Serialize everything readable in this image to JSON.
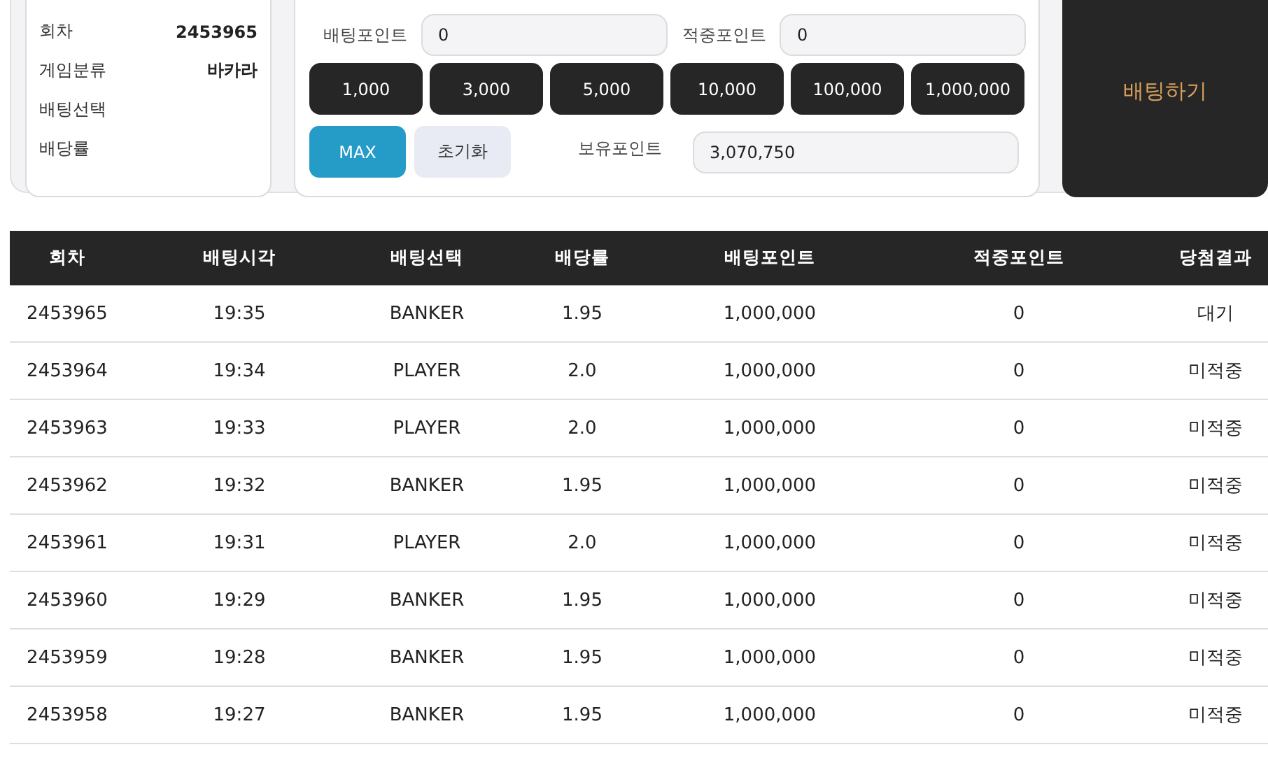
{
  "info": {
    "rows": [
      {
        "label": "회차",
        "value": "2453965"
      },
      {
        "label": "게임분류",
        "value": "바카라"
      },
      {
        "label": "배팅선택"
      },
      {
        "label": "배당률"
      }
    ]
  },
  "bet_point": {
    "label": "배팅포인트",
    "value": "0"
  },
  "win_point": {
    "label": "적중포인트",
    "value": "0"
  },
  "amount_buttons": [
    "1,000",
    "3,000",
    "5,000",
    "10,000",
    "100,000",
    "1,000,000"
  ],
  "max_button": "MAX",
  "reset_button": "초기화",
  "owned_point": {
    "label": "보유포인트",
    "value": "3,070,750"
  },
  "bet_button": "배팅하기",
  "table": {
    "columns": [
      "회차",
      "배팅시각",
      "배팅선택",
      "배당률",
      "배팅포인트",
      "적중포인트",
      "당첨결과"
    ],
    "rows": [
      [
        "2453965",
        "19:35",
        "BANKER",
        "1.95",
        "1,000,000",
        "0",
        "대기"
      ],
      [
        "2453964",
        "19:34",
        "PLAYER",
        "2.0",
        "1,000,000",
        "0",
        "미적중"
      ],
      [
        "2453963",
        "19:33",
        "PLAYER",
        "2.0",
        "1,000,000",
        "0",
        "미적중"
      ],
      [
        "2453962",
        "19:32",
        "BANKER",
        "1.95",
        "1,000,000",
        "0",
        "미적중"
      ],
      [
        "2453961",
        "19:31",
        "PLAYER",
        "2.0",
        "1,000,000",
        "0",
        "미적중"
      ],
      [
        "2453960",
        "19:29",
        "BANKER",
        "1.95",
        "1,000,000",
        "0",
        "미적중"
      ],
      [
        "2453959",
        "19:28",
        "BANKER",
        "1.95",
        "1,000,000",
        "0",
        "미적중"
      ],
      [
        "2453958",
        "19:27",
        "BANKER",
        "1.95",
        "1,000,000",
        "0",
        "미적중"
      ]
    ]
  }
}
